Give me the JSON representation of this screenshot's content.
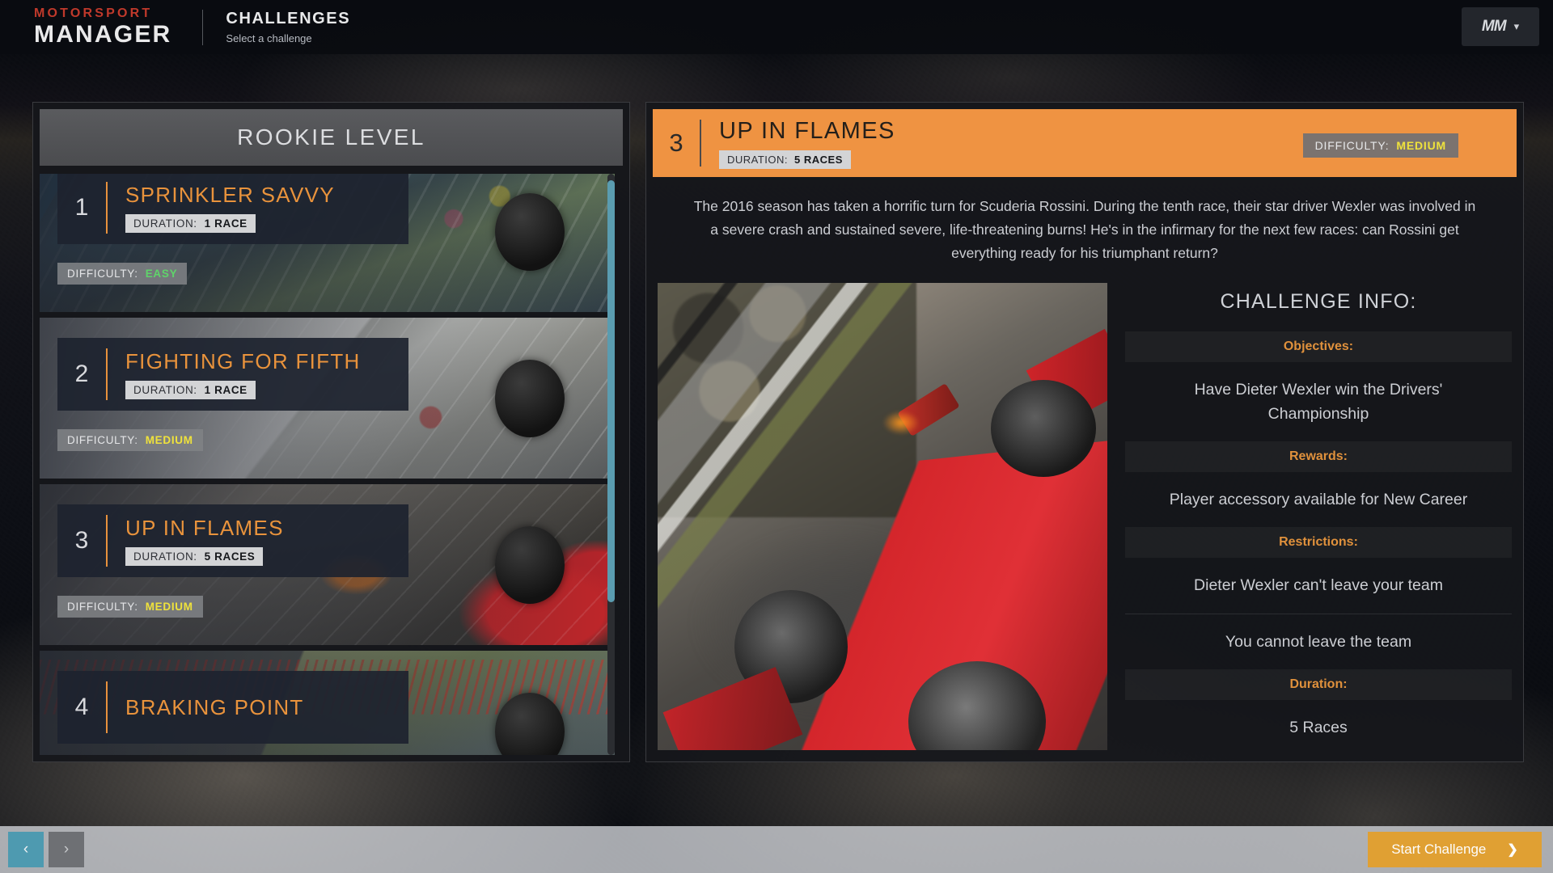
{
  "app": {
    "logo_top": "MOTORSPORT",
    "logo_bottom": "MANAGER",
    "screen_title": "CHALLENGES",
    "screen_subtitle": "Select a challenge",
    "user_badge": "MM",
    "user_chevron": "▾"
  },
  "left_panel": {
    "level_header": "ROOKIE LEVEL",
    "labels": {
      "duration": "DURATION:",
      "difficulty": "DIFFICULTY:"
    },
    "cards": [
      {
        "number": "1",
        "title": "SPRINKLER SAVVY",
        "duration": "1 RACE",
        "difficulty": "EASY",
        "difficulty_color": "#5fd36a",
        "selected": false
      },
      {
        "number": "2",
        "title": "FIGHTING FOR FIFTH",
        "duration": "1 RACE",
        "difficulty": "MEDIUM",
        "difficulty_color": "#efe23c",
        "selected": false
      },
      {
        "number": "3",
        "title": "UP IN FLAMES",
        "duration": "5 RACES",
        "difficulty": "MEDIUM",
        "difficulty_color": "#efe23c",
        "selected": true
      },
      {
        "number": "4",
        "title": "BRAKING POINT",
        "duration": "",
        "difficulty": "",
        "difficulty_color": "#efe23c",
        "selected": false
      }
    ]
  },
  "detail": {
    "number": "3",
    "title": "UP IN FLAMES",
    "duration_label": "DURATION:",
    "duration_value": "5 RACES",
    "difficulty_label": "DIFFICULTY:",
    "difficulty_value": "MEDIUM",
    "description": "The 2016 season has taken a horrific turn for Scuderia Rossini. During the tenth race, their star driver Wexler was involved in a severe crash and sustained severe, life-threatening burns! He's in the infirmary for the next few races: can Rossini get everything ready for his triumphant return?",
    "info_heading": "CHALLENGE INFO:",
    "sections": [
      {
        "label": "Objectives:",
        "values": [
          "Have Dieter Wexler win the Drivers' Championship"
        ]
      },
      {
        "label": "Rewards:",
        "values": [
          "Player accessory available for New Career"
        ]
      },
      {
        "label": "Restrictions:",
        "values": [
          "Dieter Wexler can't leave your team",
          "You cannot leave the team"
        ]
      },
      {
        "label": "Duration:",
        "values": [
          "5 Races"
        ]
      }
    ]
  },
  "footer": {
    "prev_icon": "‹",
    "next_icon": "›",
    "start_label": "Start Challenge",
    "start_arrow": "❯"
  },
  "colors": {
    "accent_orange": "#e9933c",
    "header_orange": "#ef9342",
    "button_gold": "#e0a033",
    "teal": "#4e9ab0",
    "easy_green": "#5fd36a",
    "medium_yellow": "#efe23c"
  }
}
